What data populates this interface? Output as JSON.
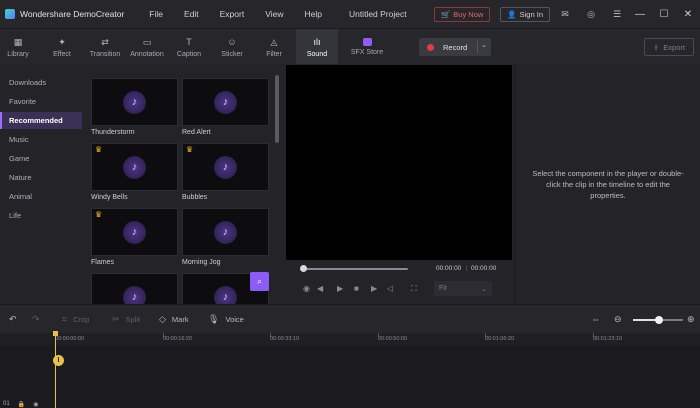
{
  "app": {
    "name": "Wondershare DemoCreator",
    "menus": [
      "File",
      "Edit",
      "Export",
      "View",
      "Help"
    ],
    "project_title": "Untitled Project",
    "buy_now": "Buy Now",
    "sign_in": "Sign In"
  },
  "toolbar": {
    "tabs": [
      {
        "label": "Library",
        "icon": "library-icon"
      },
      {
        "label": "Effect",
        "icon": "effect-icon"
      },
      {
        "label": "Transition",
        "icon": "transition-icon"
      },
      {
        "label": "Annotation",
        "icon": "annotation-icon"
      },
      {
        "label": "Caption",
        "icon": "caption-icon"
      },
      {
        "label": "Sticker",
        "icon": "sticker-icon"
      },
      {
        "label": "Filter",
        "icon": "filter-icon"
      },
      {
        "label": "Sound",
        "icon": "sound-icon",
        "active": true
      },
      {
        "label": "SFX Store",
        "icon": "sfx-store-icon"
      }
    ],
    "record_label": "Record",
    "export_label": "Export"
  },
  "sidebar": {
    "categories": [
      "Downloads",
      "Favorite",
      "Recommended",
      "Music",
      "Game",
      "Nature",
      "Animal",
      "Life"
    ],
    "active": "Recommended"
  },
  "media": {
    "items": [
      {
        "label": "Thunderstorm",
        "premium": false
      },
      {
        "label": "Red Alert",
        "premium": false
      },
      {
        "label": "Windy Bells",
        "premium": true
      },
      {
        "label": "Bubbles",
        "premium": true
      },
      {
        "label": "Flames",
        "premium": true
      },
      {
        "label": "Morning Jog",
        "premium": false
      },
      {
        "label": "",
        "premium": false
      },
      {
        "label": "",
        "premium": false
      }
    ]
  },
  "player": {
    "current_time": "00:00:00",
    "total_time": "00:00:00",
    "fit_label": "Fit",
    "progress": 0
  },
  "properties": {
    "message": "Select the component in the player or double-click the clip in the timeline to edit the properties."
  },
  "timeline": {
    "crop_label": "Crop",
    "split_label": "Split",
    "mark_label": "Mark",
    "voice_label": "Voice",
    "zoom_level": 0.52,
    "ruler_ticks": [
      "00:00:00:00",
      "00:00:16:20",
      "00:00:33:10",
      "00:00:50:00",
      "00:01:06:20",
      "00:01:23:10"
    ],
    "track_number": "01"
  }
}
